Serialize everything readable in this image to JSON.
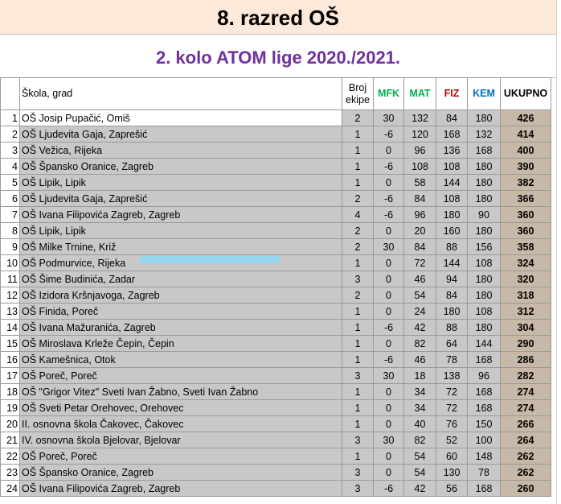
{
  "title": "8. razred OŠ",
  "subtitle": "2. kolo ATOM lige 2020./2021.",
  "headers": {
    "school": "Škola, grad",
    "teams_line1": "Broj",
    "teams_line2": "ekipe",
    "mfk": "MFK",
    "mat": "MAT",
    "fiz": "FIZ",
    "kem": "KEM",
    "total": "UKUPNO"
  },
  "colors": {
    "title_bg": "#fde9d9",
    "subtitle_text": "#7030a0",
    "mfk": "#00b050",
    "mat": "#00b050",
    "fiz": "#c00000",
    "kem": "#0070c0",
    "row_bg": "#c8c8c8",
    "total_bg": "#c8b8a8"
  },
  "rows": [
    {
      "n": "1",
      "school": "OŠ Josip Pupačić, Omiš",
      "teams": "2",
      "mfk": "30",
      "mat": "132",
      "fiz": "84",
      "kem": "180",
      "total": "426"
    },
    {
      "n": "2",
      "school": "OŠ Ljudevita Gaja, Zaprešić",
      "teams": "1",
      "mfk": "-6",
      "mat": "120",
      "fiz": "168",
      "kem": "132",
      "total": "414"
    },
    {
      "n": "3",
      "school": "OŠ Vežica, Rijeka",
      "teams": "1",
      "mfk": "0",
      "mat": "96",
      "fiz": "136",
      "kem": "168",
      "total": "400"
    },
    {
      "n": "4",
      "school": "OŠ Špansko Oranice, Zagreb",
      "teams": "1",
      "mfk": "-6",
      "mat": "108",
      "fiz": "108",
      "kem": "180",
      "total": "390"
    },
    {
      "n": "5",
      "school": "OŠ Lipik, Lipik",
      "teams": "1",
      "mfk": "0",
      "mat": "58",
      "fiz": "144",
      "kem": "180",
      "total": "382"
    },
    {
      "n": "6",
      "school": "OŠ Ljudevita Gaja, Zaprešić",
      "teams": "2",
      "mfk": "-6",
      "mat": "84",
      "fiz": "108",
      "kem": "180",
      "total": "366"
    },
    {
      "n": "7",
      "school": "OŠ Ivana Filipovića Zagreb, Zagreb",
      "teams": "4",
      "mfk": "-6",
      "mat": "96",
      "fiz": "180",
      "kem": "90",
      "total": "360"
    },
    {
      "n": "8",
      "school": "OŠ Lipik, Lipik",
      "teams": "2",
      "mfk": "0",
      "mat": "20",
      "fiz": "160",
      "kem": "180",
      "total": "360"
    },
    {
      "n": "9",
      "school": "OŠ Milke Trnine, Križ",
      "teams": "2",
      "mfk": "30",
      "mat": "84",
      "fiz": "88",
      "kem": "156",
      "total": "358"
    },
    {
      "n": "10",
      "school": "OŠ Podmurvice, Rijeka",
      "teams": "1",
      "mfk": "0",
      "mat": "72",
      "fiz": "144",
      "kem": "108",
      "total": "324"
    },
    {
      "n": "11",
      "school": "OŠ Šime Budinića, Zadar",
      "teams": "3",
      "mfk": "0",
      "mat": "46",
      "fiz": "94",
      "kem": "180",
      "total": "320"
    },
    {
      "n": "12",
      "school": "OŠ Izidora Kršnjavoga, Zagreb",
      "teams": "2",
      "mfk": "0",
      "mat": "54",
      "fiz": "84",
      "kem": "180",
      "total": "318"
    },
    {
      "n": "13",
      "school": "OŠ Finida, Poreč",
      "teams": "1",
      "mfk": "0",
      "mat": "24",
      "fiz": "180",
      "kem": "108",
      "total": "312"
    },
    {
      "n": "14",
      "school": "OŠ Ivana Mažuranića, Zagreb",
      "teams": "1",
      "mfk": "-6",
      "mat": "42",
      "fiz": "88",
      "kem": "180",
      "total": "304"
    },
    {
      "n": "15",
      "school": "OŠ Miroslava Krleže Čepin, Čepin",
      "teams": "1",
      "mfk": "0",
      "mat": "82",
      "fiz": "64",
      "kem": "144",
      "total": "290"
    },
    {
      "n": "16",
      "school": "OŠ Kamešnica, Otok",
      "teams": "1",
      "mfk": "-6",
      "mat": "46",
      "fiz": "78",
      "kem": "168",
      "total": "286"
    },
    {
      "n": "17",
      "school": "OŠ Poreč, Poreč",
      "teams": "3",
      "mfk": "30",
      "mat": "18",
      "fiz": "138",
      "kem": "96",
      "total": "282"
    },
    {
      "n": "18",
      "school": "OŠ \"Grigor Vitez\" Sveti Ivan Žabno, Sveti Ivan Žabno",
      "teams": "1",
      "mfk": "0",
      "mat": "34",
      "fiz": "72",
      "kem": "168",
      "total": "274"
    },
    {
      "n": "19",
      "school": "OŠ Sveti Petar Orehovec, Orehovec",
      "teams": "1",
      "mfk": "0",
      "mat": "34",
      "fiz": "72",
      "kem": "168",
      "total": "274"
    },
    {
      "n": "20",
      "school": "II. osnovna škola Čakovec, Čakovec",
      "teams": "1",
      "mfk": "0",
      "mat": "40",
      "fiz": "76",
      "kem": "150",
      "total": "266"
    },
    {
      "n": "21",
      "school": "IV. osnovna škola Bjelovar, Bjelovar",
      "teams": "3",
      "mfk": "30",
      "mat": "82",
      "fiz": "52",
      "kem": "100",
      "total": "264"
    },
    {
      "n": "22",
      "school": "OŠ Poreč, Poreč",
      "teams": "1",
      "mfk": "0",
      "mat": "54",
      "fiz": "60",
      "kem": "148",
      "total": "262"
    },
    {
      "n": "23",
      "school": "OŠ Špansko Oranice, Zagreb",
      "teams": "3",
      "mfk": "0",
      "mat": "54",
      "fiz": "130",
      "kem": "78",
      "total": "262"
    },
    {
      "n": "24",
      "school": "OŠ Ivana Filipovića Zagreb, Zagreb",
      "teams": "3",
      "mfk": "-6",
      "mat": "42",
      "fiz": "56",
      "kem": "168",
      "total": "260"
    }
  ]
}
